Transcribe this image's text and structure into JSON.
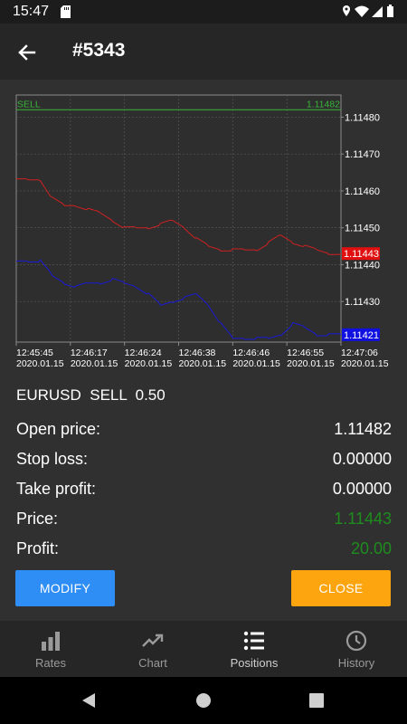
{
  "status": {
    "time": "15:47",
    "icons": [
      "sd-card-icon",
      "wifi-icon",
      "signal-icon",
      "battery-icon"
    ]
  },
  "header": {
    "title": "#5343",
    "back_icon": "back-arrow-icon"
  },
  "chart_data": {
    "type": "line",
    "series": [
      {
        "values": [
          1.11463,
          1.11463,
          1.11463,
          1.11458,
          1.11456,
          1.11456,
          1.11455,
          1.11454,
          1.11452,
          1.1145,
          1.1145,
          1.1145,
          1.11451,
          1.11452,
          1.1145,
          1.11447,
          1.11445,
          1.11444,
          1.11444,
          1.11444,
          1.11444,
          1.11446,
          1.11448,
          1.11446,
          1.11445,
          1.11444,
          1.11443,
          1.11443
        ],
        "color": "#d02020"
      },
      {
        "values": [
          1.11441,
          1.11441,
          1.11441,
          1.11437,
          1.11435,
          1.11434,
          1.11435,
          1.11435,
          1.11436,
          1.11435,
          1.11434,
          1.11432,
          1.11429,
          1.1143,
          1.11431,
          1.11432,
          1.11429,
          1.11424,
          1.1142,
          1.1142,
          1.1142,
          1.1142,
          1.11421,
          1.11424,
          1.11423,
          1.11421,
          1.11421,
          1.11421
        ],
        "color": "#1a1ad8"
      }
    ],
    "sell_line": {
      "label": "SELL",
      "value": 1.11482,
      "color": "#39b539"
    },
    "price_labels": [
      {
        "value": 1.11443,
        "text": "1.11443",
        "bg": "#e01010"
      },
      {
        "value": 1.11421,
        "text": "1.11421",
        "bg": "#1010e0"
      }
    ],
    "y_ticks": [
      "1.11480",
      "1.11470",
      "1.11460",
      "1.11450",
      "1.11440",
      "1.11430"
    ],
    "ylim": [
      1.11419,
      1.11486
    ],
    "x_ticks": [
      {
        "time": "12:45:45",
        "date": "2020.01.15"
      },
      {
        "time": "12:46:17",
        "date": "2020.01.15"
      },
      {
        "time": "12:46:24",
        "date": "2020.01.15"
      },
      {
        "time": "12:46:38",
        "date": "2020.01.15"
      },
      {
        "time": "12:46:46",
        "date": "2020.01.15"
      },
      {
        "time": "12:46:55",
        "date": "2020.01.15"
      },
      {
        "time": "12:47:06",
        "date": "2020.01.15"
      }
    ],
    "grid": true
  },
  "trade": {
    "summary": "EURUSD  SELL  0.50"
  },
  "details": [
    {
      "label": "Open price:",
      "value": "1.11482",
      "color": "#ffffff"
    },
    {
      "label": "Stop loss:",
      "value": "0.00000",
      "color": "#ffffff"
    },
    {
      "label": "Take profit:",
      "value": "0.00000",
      "color": "#ffffff"
    },
    {
      "label": "Price:",
      "value": "1.11443",
      "color": "#1e8c1e"
    },
    {
      "label": "Profit:",
      "value": "20.00",
      "color": "#1e8c1e"
    }
  ],
  "actions": {
    "modify_label": "MODIFY",
    "close_label": "CLOSE",
    "modify_color": "#2f8ef5",
    "close_color": "#fca50f"
  },
  "nav": [
    {
      "label": "Rates",
      "icon": "bar-chart-icon"
    },
    {
      "label": "Chart",
      "icon": "trending-icon"
    },
    {
      "label": "Positions",
      "icon": "list-icon",
      "active": true
    },
    {
      "label": "History",
      "icon": "clock-icon"
    }
  ]
}
